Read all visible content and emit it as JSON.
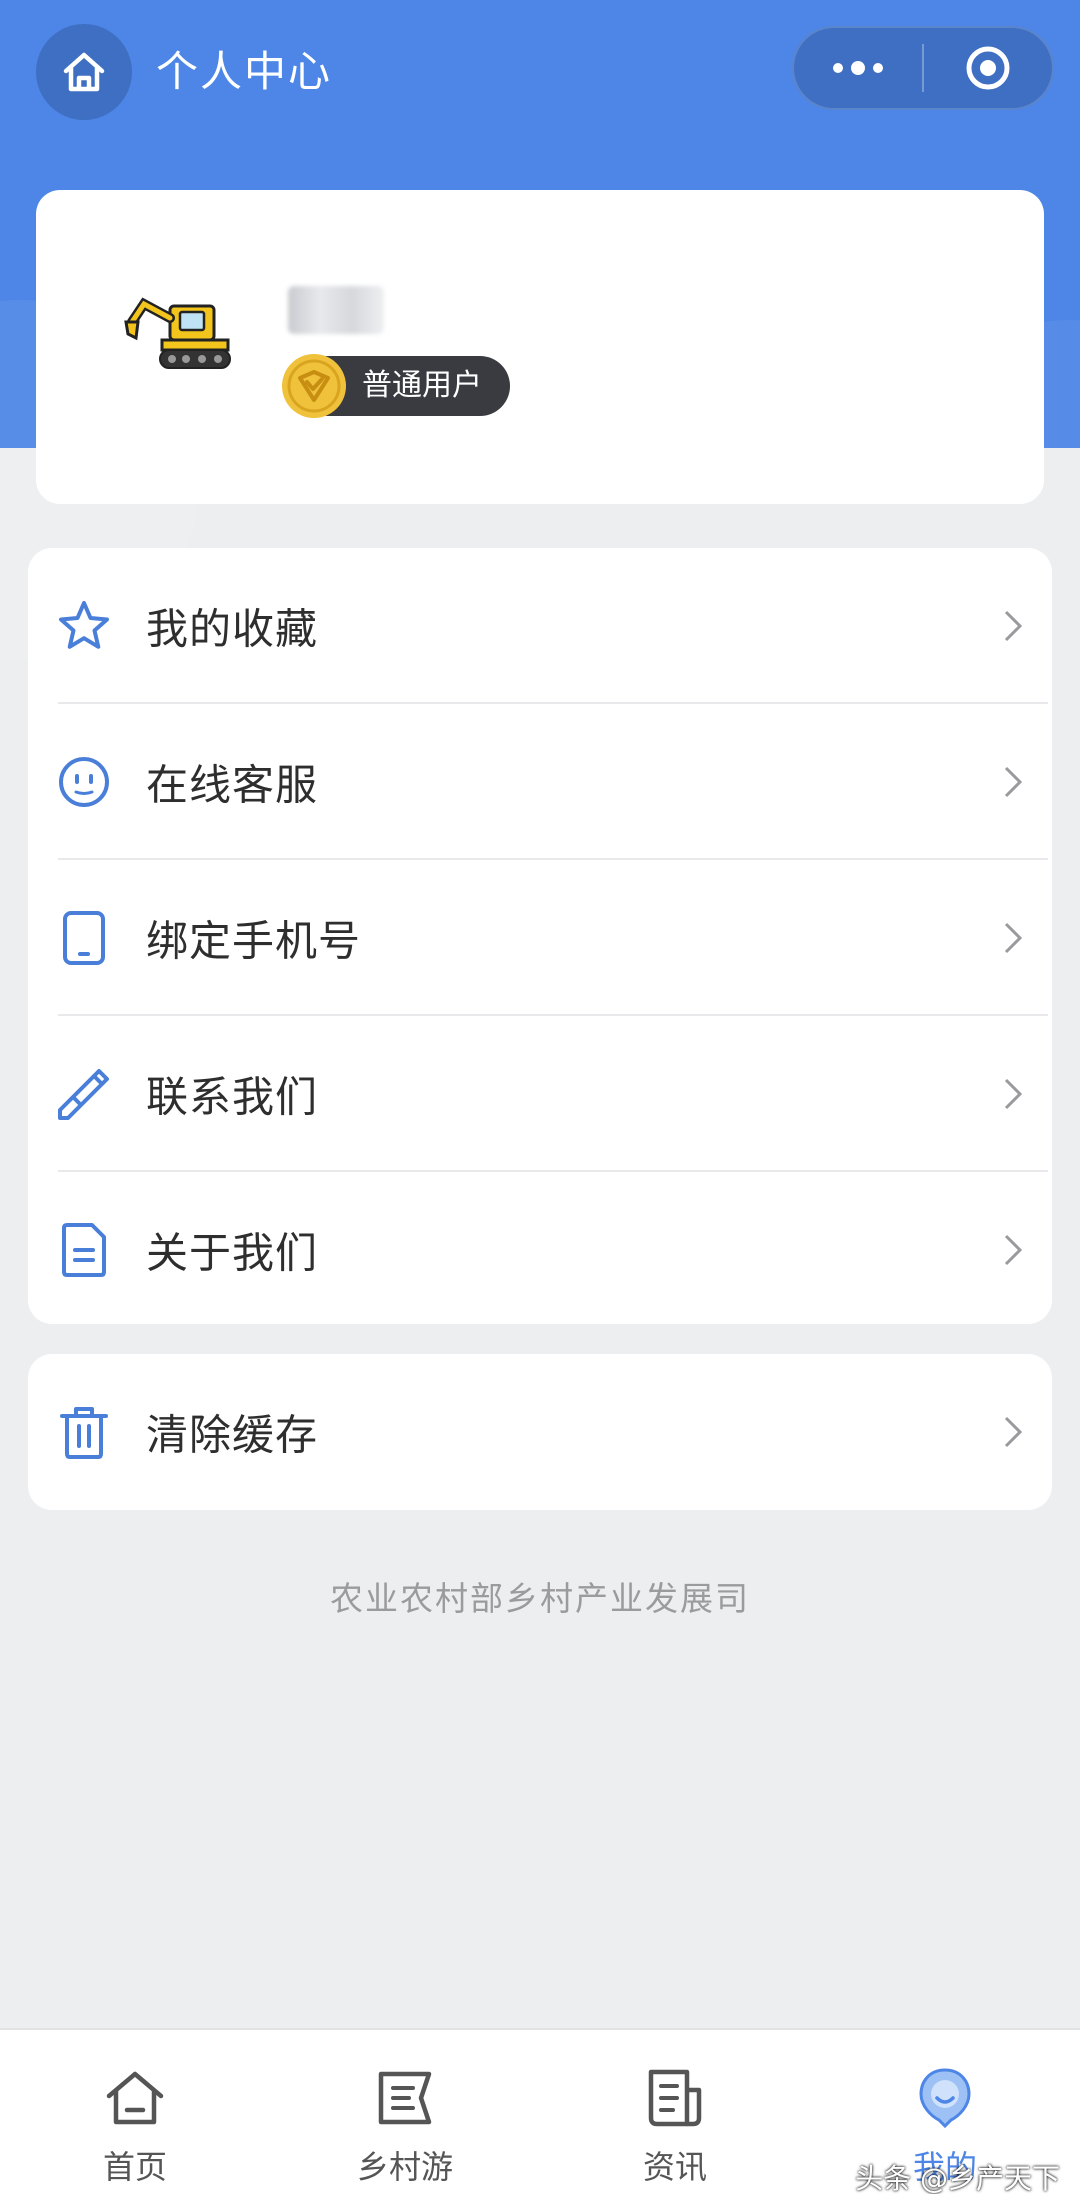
{
  "header": {
    "title": "个人中心",
    "home_icon": "home-icon",
    "more_icon": "more-dots-icon",
    "close_icon": "target-icon"
  },
  "profile": {
    "badge_label": "普通用户",
    "badge_icon": "shield-check-icon",
    "avatar_icon": "excavator-avatar"
  },
  "menu_group_1": [
    {
      "label": "我的收藏",
      "icon": "star-icon"
    },
    {
      "label": "在线客服",
      "icon": "smile-face-icon"
    },
    {
      "label": "绑定手机号",
      "icon": "phone-icon"
    },
    {
      "label": "联系我们",
      "icon": "pencil-icon"
    },
    {
      "label": "关于我们",
      "icon": "document-icon"
    }
  ],
  "menu_group_2": [
    {
      "label": "清除缓存",
      "icon": "trash-icon"
    }
  ],
  "footer": {
    "text": "农业农村部乡村产业发展司"
  },
  "tabbar": [
    {
      "label": "首页",
      "icon": "home-tab-icon",
      "active": false
    },
    {
      "label": "乡村游",
      "icon": "tour-tab-icon",
      "active": false
    },
    {
      "label": "资讯",
      "icon": "news-tab-icon",
      "active": false
    },
    {
      "label": "我的",
      "icon": "profile-tab-icon",
      "active": true
    }
  ],
  "watermark": "头条 @乡产天下",
  "colors": {
    "primary": "#4D86E6",
    "icon_blue": "#4A7FD9",
    "background": "#EDEEF0",
    "badge_bg": "#3A3B40",
    "badge_gold": "#F0C23C"
  }
}
